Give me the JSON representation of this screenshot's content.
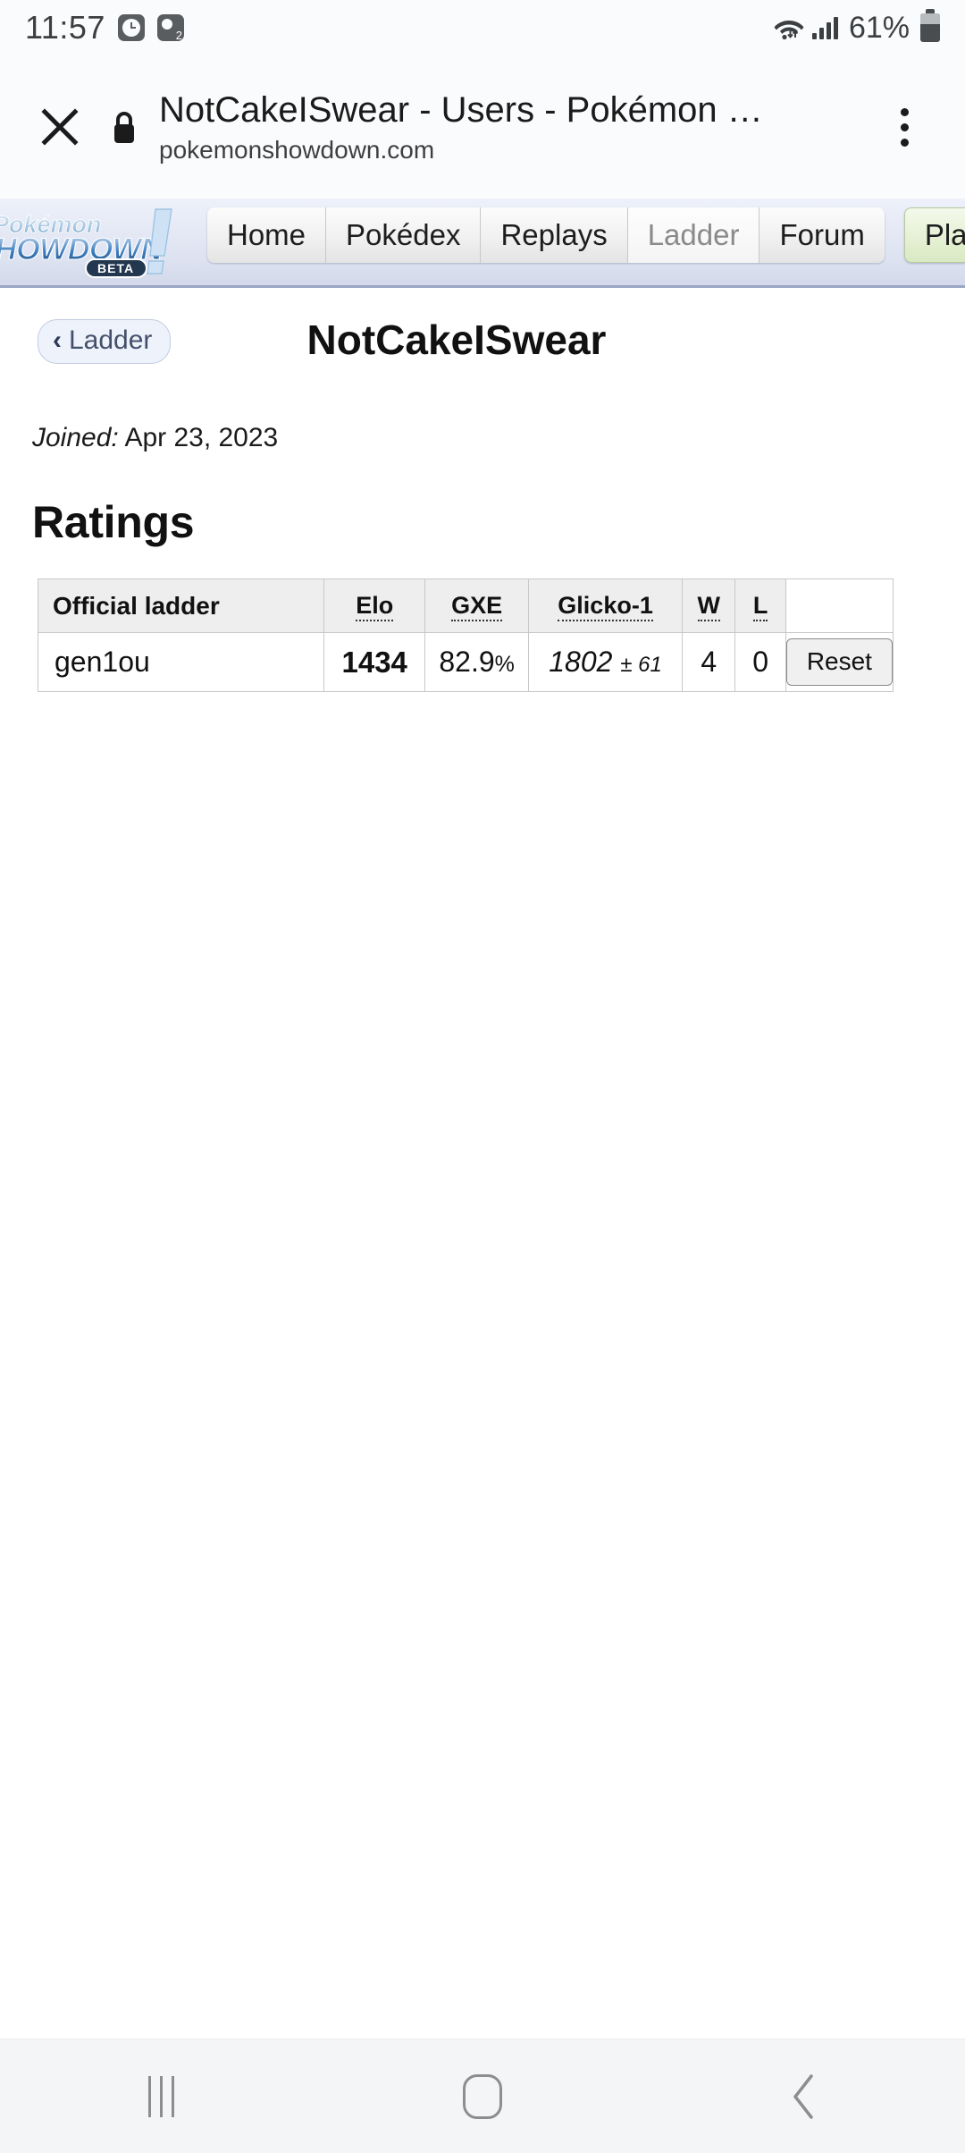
{
  "status_bar": {
    "time": "11:57",
    "alarm_icon": "alarm-clock-icon",
    "dual_app_icon": "dual-app-icon",
    "dual_app_badge": "2",
    "wifi_icon": "wifi-icon",
    "signal_icon": "cellular-signal-icon",
    "battery_percent": "61%",
    "battery_icon": "battery-icon"
  },
  "browser": {
    "close_icon": "close-icon",
    "lock_icon": "lock-icon",
    "page_title": "NotCakeISwear - Users - Pokémon …",
    "page_url": "pokemonshowdown.com",
    "menu_icon": "overflow-menu-icon"
  },
  "site_nav": {
    "logo_alt": "Pokémon Showdown BETA",
    "items": [
      {
        "label": "Home",
        "current": false
      },
      {
        "label": "Pokédex",
        "current": false
      },
      {
        "label": "Replays",
        "current": false
      },
      {
        "label": "Ladder",
        "current": true
      },
      {
        "label": "Forum",
        "current": false
      }
    ],
    "play_label": "Play"
  },
  "page": {
    "back_button": {
      "chevron": "‹",
      "label": "Ladder"
    },
    "username": "NotCakeISwear",
    "joined_label": "Joined:",
    "joined_date": "Apr 23, 2023",
    "ratings_heading": "Ratings"
  },
  "ratings_table": {
    "columns": [
      "Official ladder",
      "Elo",
      "GXE",
      "Glicko-1",
      "W",
      "L",
      ""
    ],
    "rows": [
      {
        "format": "gen1ou",
        "elo": "1434",
        "gxe_value": "82.9",
        "gxe_unit": "%",
        "glicko_value": "1802",
        "glicko_deviation": "± 61",
        "wins": "4",
        "losses": "0",
        "reset_label": "Reset"
      }
    ]
  },
  "android_nav": {
    "recents_icon": "recents-icon",
    "home_icon": "home-icon",
    "back_icon": "back-icon"
  },
  "colors": {
    "nav_background": "#dde2f1",
    "play_button": "#e4f0d2",
    "table_header": "#eeeeee",
    "accent_link": "#44506b"
  }
}
